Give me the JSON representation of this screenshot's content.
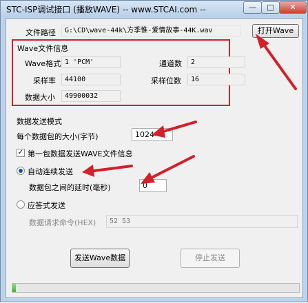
{
  "window": {
    "title": "STC-ISP调试接口 (播放WAVE) -- www.STCAI.com --"
  },
  "file": {
    "label": "文件路径",
    "path": "G:\\CD\\wave-44k\\方季惟-爱情故事-44K.wav",
    "open_button": "打开Wave"
  },
  "wave_info": {
    "title": "Wave文件信息",
    "format_label": "Wave格式",
    "format_value": "1 'PCM'",
    "channels_label": "通道数",
    "channels_value": "2",
    "sample_rate_label": "采样率",
    "sample_rate_value": "44100",
    "bits_label": "采样位数",
    "bits_value": "16",
    "data_size_label": "数据大小",
    "data_size_value": "49900032"
  },
  "send": {
    "mode_label": "数据发送模式",
    "packet_size_label": "每个数据包的大小(字节)",
    "packet_size_value": "1024",
    "first_packet_label": "第一包数据发送WAVE文件信息",
    "first_packet_checked": true,
    "auto_label": "自动连续发送",
    "auto_selected": true,
    "delay_label": "数据包之间的延时(毫秒)",
    "delay_value": "0",
    "response_label": "应答式发送",
    "response_selected": false,
    "request_cmd_label": "数据请求命令(HEX)",
    "request_cmd_value": "52 53"
  },
  "buttons": {
    "send": "发送Wave数据",
    "stop": "停止发送"
  },
  "progress": {
    "fraction": 0.012
  },
  "colors": {
    "annotation_red": "#d3202a",
    "progress_green": "#37b534"
  }
}
